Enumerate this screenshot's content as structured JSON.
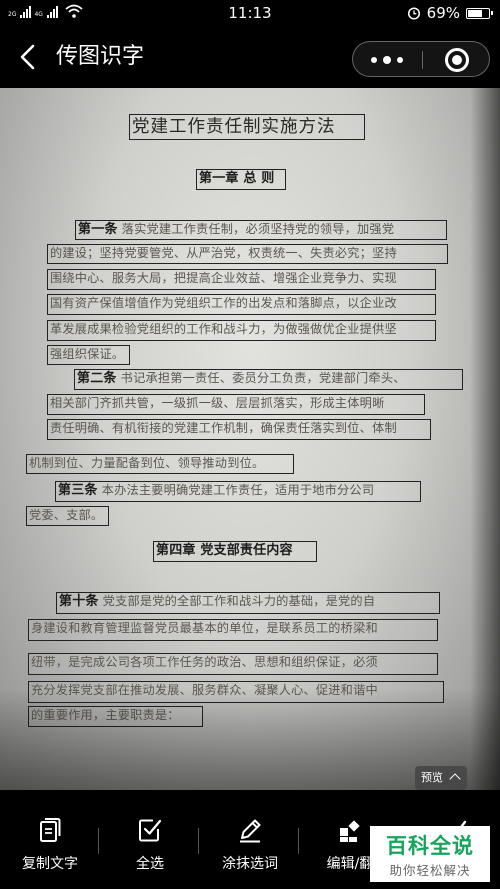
{
  "status_bar": {
    "net1": "2G",
    "net2": "4G",
    "time": "11:13",
    "battery": "69%",
    "battery_level": 0.69
  },
  "nav": {
    "title": "传图识字"
  },
  "doc": {
    "title": "党建工作责任制实施方法",
    "chapter1": "第一章 总 则",
    "l1_head": "第一条",
    "l1": " 落实党建工作责任制，必须坚持党的领导，加强党",
    "l2": "的建设；坚持党要管党、从严治党，权责统一、失责必究；坚持",
    "l3": "围绕中心、服务大局，把提高企业效益、增强企业竞争力、实现",
    "l4": "国有资产保值增值作为党组织工作的出发点和落脚点，以企业改",
    "l5": "革发展成果检验党组织的工作和战斗力，为做强做优企业提供坚",
    "l6": "强组织保证。",
    "l7_head": "第二条",
    "l7": " 书记承担第一责任、委员分工负责，党建部门牵头、",
    "l8": "相关部门齐抓共管，一级抓一级、层层抓落实，形成主体明晰",
    "l9": "责任明确、有机衔接的党建工作机制，确保责任落实到位、体制",
    "l10": "机制到位、力量配备到位、领导推动到位。",
    "l11_head": "第三条",
    "l11": " 本办法主要明确党建工作责任，适用于地市分公司",
    "l12": "党委、支部。",
    "chapter4": "第四章 党支部责任内容",
    "l13_head": "第十条",
    "l13": " 党支部是党的全部工作和战斗力的基础，是党的自",
    "l14": "身建设和教育管理监督党员最基本的单位，是联系员工的桥梁和",
    "l15": "纽带，是完成公司各项工作任务的政治、思想和组织保证，必须",
    "l16": "充分发挥党支部在推动发展、服务群众、凝聚人心、促进和谐中",
    "l17": "的重要作用，主要职责是："
  },
  "preview": {
    "label": "预览"
  },
  "toolbar": {
    "copy": "复制文字",
    "select_all": "全选",
    "erase": "涂抹选词",
    "edit": "编辑/翻"
  },
  "brand": {
    "title": "百科全说",
    "subtitle": "助你轻松解决"
  }
}
